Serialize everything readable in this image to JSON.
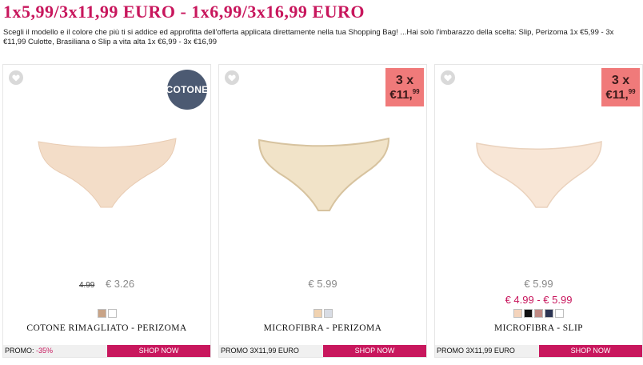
{
  "header": {
    "title": "1x5,99/3x11,99 EURO - 1x6,99/3x16,99 EURO",
    "intro": "Scegli il modello e il colore che più ti si addice ed approfitta dell'offerta applicata direttamente nella tua Shopping Bag! ...Hai solo l'imbarazzo della scelta: Slip, Perizoma 1x €5,99 - 3x €11,99 Culotte, Brasiliana o Slip a vita alta 1x €6,99 - 3x €16,99"
  },
  "colors": {
    "accent": "#c8175d",
    "badge_round": "#4c5a72",
    "badge_promo": "#f07a7a"
  },
  "products": [
    {
      "name": "COTONE RIMAGLIATO - PERIZOMA",
      "badge": "COTONE",
      "old_price": "4.99",
      "price": "€ 3.26",
      "promo_label": "PROMO: ",
      "promo_discount": "-35%",
      "shop_label": "SHOP NOW",
      "swatches": [
        "#c9a487",
        "#ffffff"
      ]
    },
    {
      "name": "MICROFIBRA - PERIZOMA",
      "badge_qty": "3 x",
      "badge_price": "€11,",
      "badge_cents": "99",
      "price": "€ 5.99",
      "promo_label": "PROMO 3X11,99 EURO",
      "shop_label": "SHOP NOW",
      "swatches": [
        "#f0d2b0",
        "#d8dce4"
      ]
    },
    {
      "name": "MICROFIBRA - SLIP",
      "badge_qty": "3 x",
      "badge_price": "€11,",
      "badge_cents": "99",
      "price": "€ 5.99",
      "price_range": "€ 4.99 - € 5.99",
      "promo_label": "PROMO 3X11,99 EURO",
      "shop_label": "SHOP NOW",
      "swatches": [
        "#f4d4bc",
        "#111111",
        "#c08a84",
        "#2c3553",
        "#ffffff"
      ]
    }
  ]
}
